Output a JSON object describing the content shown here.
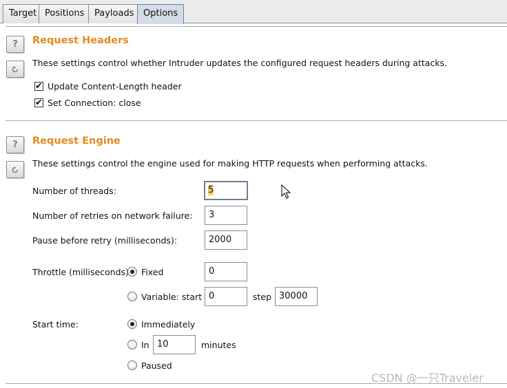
{
  "tabs": [
    {
      "label": "Target"
    },
    {
      "label": "Positions"
    },
    {
      "label": "Payloads"
    },
    {
      "label": "Options"
    }
  ],
  "request_headers": {
    "title": "Request Headers",
    "description": "These settings control whether Intruder updates the configured request headers during attacks.",
    "help_icon": "?",
    "options": [
      {
        "label": "Update Content-Length header",
        "checked": true
      },
      {
        "label": "Set Connection: close",
        "checked": true
      }
    ]
  },
  "request_engine": {
    "title": "Request Engine",
    "description": "These settings control the engine used for making HTTP requests when performing attacks.",
    "help_icon": "?",
    "threads_label": "Number of threads:",
    "threads_value": "5",
    "retries_label": "Number of retries on network failure:",
    "retries_value": "3",
    "pause_label": "Pause before retry (milliseconds):",
    "pause_value": "2000",
    "throttle_label": "Throttle (milliseconds):",
    "throttle_fixed_label": "Fixed",
    "throttle_fixed_value": "0",
    "throttle_variable_label": "Variable:",
    "throttle_start_label": "start",
    "throttle_start_value": "0",
    "throttle_step_label": "step",
    "throttle_step_value": "30000",
    "start_time_label": "Start time:",
    "start_immediately_label": "Immediately",
    "start_in_label": "In",
    "start_in_value": "10",
    "start_minutes_label": "minutes",
    "start_paused_label": "Paused"
  },
  "watermark": "CSDN @一只Traveler"
}
